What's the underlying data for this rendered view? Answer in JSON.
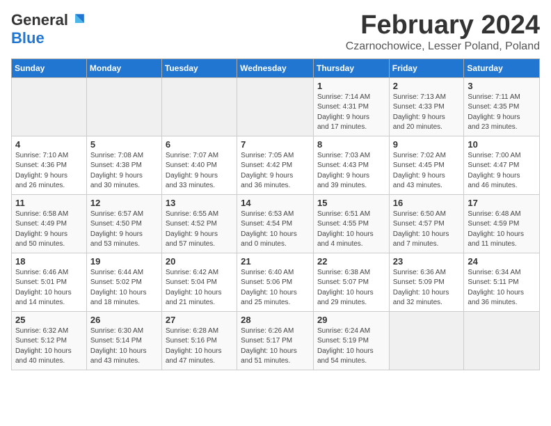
{
  "header": {
    "logo_general": "General",
    "logo_blue": "Blue",
    "month": "February 2024",
    "location": "Czarnochowice, Lesser Poland, Poland"
  },
  "weekdays": [
    "Sunday",
    "Monday",
    "Tuesday",
    "Wednesday",
    "Thursday",
    "Friday",
    "Saturday"
  ],
  "weeks": [
    [
      {
        "day": "",
        "info": ""
      },
      {
        "day": "",
        "info": ""
      },
      {
        "day": "",
        "info": ""
      },
      {
        "day": "",
        "info": ""
      },
      {
        "day": "1",
        "info": "Sunrise: 7:14 AM\nSunset: 4:31 PM\nDaylight: 9 hours\nand 17 minutes."
      },
      {
        "day": "2",
        "info": "Sunrise: 7:13 AM\nSunset: 4:33 PM\nDaylight: 9 hours\nand 20 minutes."
      },
      {
        "day": "3",
        "info": "Sunrise: 7:11 AM\nSunset: 4:35 PM\nDaylight: 9 hours\nand 23 minutes."
      }
    ],
    [
      {
        "day": "4",
        "info": "Sunrise: 7:10 AM\nSunset: 4:36 PM\nDaylight: 9 hours\nand 26 minutes."
      },
      {
        "day": "5",
        "info": "Sunrise: 7:08 AM\nSunset: 4:38 PM\nDaylight: 9 hours\nand 30 minutes."
      },
      {
        "day": "6",
        "info": "Sunrise: 7:07 AM\nSunset: 4:40 PM\nDaylight: 9 hours\nand 33 minutes."
      },
      {
        "day": "7",
        "info": "Sunrise: 7:05 AM\nSunset: 4:42 PM\nDaylight: 9 hours\nand 36 minutes."
      },
      {
        "day": "8",
        "info": "Sunrise: 7:03 AM\nSunset: 4:43 PM\nDaylight: 9 hours\nand 39 minutes."
      },
      {
        "day": "9",
        "info": "Sunrise: 7:02 AM\nSunset: 4:45 PM\nDaylight: 9 hours\nand 43 minutes."
      },
      {
        "day": "10",
        "info": "Sunrise: 7:00 AM\nSunset: 4:47 PM\nDaylight: 9 hours\nand 46 minutes."
      }
    ],
    [
      {
        "day": "11",
        "info": "Sunrise: 6:58 AM\nSunset: 4:49 PM\nDaylight: 9 hours\nand 50 minutes."
      },
      {
        "day": "12",
        "info": "Sunrise: 6:57 AM\nSunset: 4:50 PM\nDaylight: 9 hours\nand 53 minutes."
      },
      {
        "day": "13",
        "info": "Sunrise: 6:55 AM\nSunset: 4:52 PM\nDaylight: 9 hours\nand 57 minutes."
      },
      {
        "day": "14",
        "info": "Sunrise: 6:53 AM\nSunset: 4:54 PM\nDaylight: 10 hours\nand 0 minutes."
      },
      {
        "day": "15",
        "info": "Sunrise: 6:51 AM\nSunset: 4:55 PM\nDaylight: 10 hours\nand 4 minutes."
      },
      {
        "day": "16",
        "info": "Sunrise: 6:50 AM\nSunset: 4:57 PM\nDaylight: 10 hours\nand 7 minutes."
      },
      {
        "day": "17",
        "info": "Sunrise: 6:48 AM\nSunset: 4:59 PM\nDaylight: 10 hours\nand 11 minutes."
      }
    ],
    [
      {
        "day": "18",
        "info": "Sunrise: 6:46 AM\nSunset: 5:01 PM\nDaylight: 10 hours\nand 14 minutes."
      },
      {
        "day": "19",
        "info": "Sunrise: 6:44 AM\nSunset: 5:02 PM\nDaylight: 10 hours\nand 18 minutes."
      },
      {
        "day": "20",
        "info": "Sunrise: 6:42 AM\nSunset: 5:04 PM\nDaylight: 10 hours\nand 21 minutes."
      },
      {
        "day": "21",
        "info": "Sunrise: 6:40 AM\nSunset: 5:06 PM\nDaylight: 10 hours\nand 25 minutes."
      },
      {
        "day": "22",
        "info": "Sunrise: 6:38 AM\nSunset: 5:07 PM\nDaylight: 10 hours\nand 29 minutes."
      },
      {
        "day": "23",
        "info": "Sunrise: 6:36 AM\nSunset: 5:09 PM\nDaylight: 10 hours\nand 32 minutes."
      },
      {
        "day": "24",
        "info": "Sunrise: 6:34 AM\nSunset: 5:11 PM\nDaylight: 10 hours\nand 36 minutes."
      }
    ],
    [
      {
        "day": "25",
        "info": "Sunrise: 6:32 AM\nSunset: 5:12 PM\nDaylight: 10 hours\nand 40 minutes."
      },
      {
        "day": "26",
        "info": "Sunrise: 6:30 AM\nSunset: 5:14 PM\nDaylight: 10 hours\nand 43 minutes."
      },
      {
        "day": "27",
        "info": "Sunrise: 6:28 AM\nSunset: 5:16 PM\nDaylight: 10 hours\nand 47 minutes."
      },
      {
        "day": "28",
        "info": "Sunrise: 6:26 AM\nSunset: 5:17 PM\nDaylight: 10 hours\nand 51 minutes."
      },
      {
        "day": "29",
        "info": "Sunrise: 6:24 AM\nSunset: 5:19 PM\nDaylight: 10 hours\nand 54 minutes."
      },
      {
        "day": "",
        "info": ""
      },
      {
        "day": "",
        "info": ""
      }
    ]
  ]
}
